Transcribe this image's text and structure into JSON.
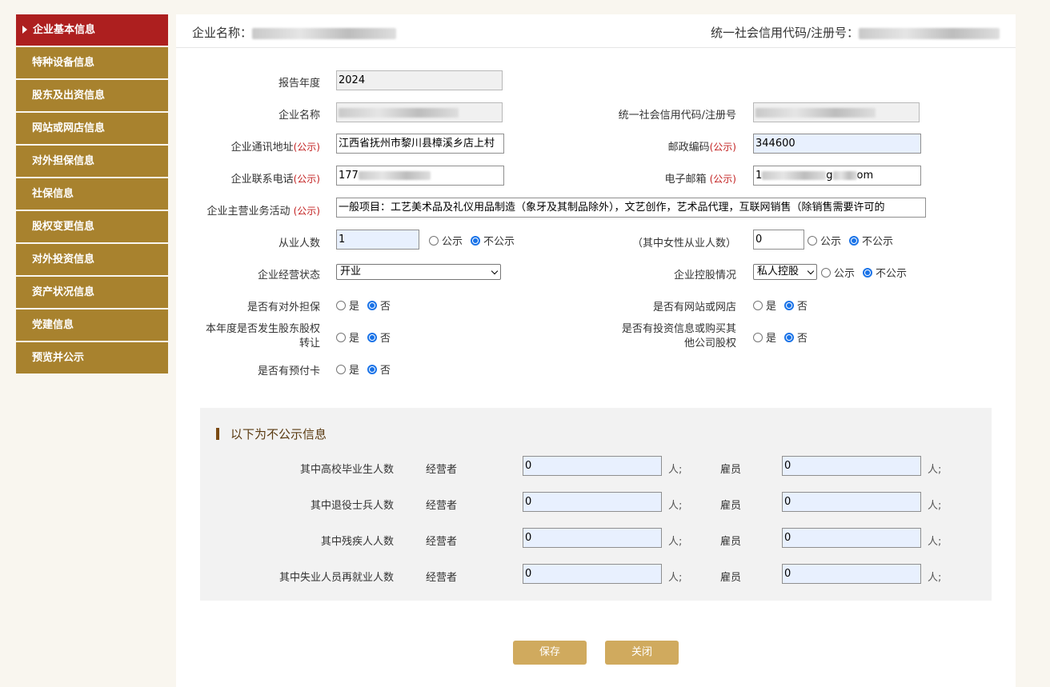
{
  "sidebar": {
    "items": [
      {
        "label": "企业基本信息",
        "active": true
      },
      {
        "label": "特种设备信息"
      },
      {
        "label": "股东及出资信息"
      },
      {
        "label": "网站或网店信息"
      },
      {
        "label": "对外担保信息"
      },
      {
        "label": "社保信息"
      },
      {
        "label": "股权变更信息"
      },
      {
        "label": "对外投资信息"
      },
      {
        "label": "资产状况信息"
      },
      {
        "label": "党建信息"
      },
      {
        "label": "预览并公示"
      }
    ]
  },
  "header": {
    "company_label": "企业名称：",
    "credit_label": "统一社会信用代码/注册号："
  },
  "form": {
    "report_year_label": "报告年度",
    "report_year_value": "2024",
    "company_name_label": "企业名称",
    "credit_code_label": "统一社会信用代码/注册号",
    "address_label": "企业通讯地址",
    "address_value": "江西省抚州市黎川县樟溪乡店上村",
    "public_tag": "(公示)",
    "postcode_label": "邮政编码",
    "postcode_value": "344600",
    "phone_label": "企业联系电话",
    "phone_value": "177",
    "email_label": "电子邮箱",
    "email_value_start": "1",
    "email_value_mid": "g",
    "email_value_end": "om",
    "business_label": "企业主营业务活动",
    "business_value": "一般项目：工艺美术品及礼仪用品制造（象牙及其制品除外），文艺创作，艺术品代理，互联网销售（除销售需要许可的",
    "employees_label": "从业人数",
    "employees_value": "1",
    "female_label": "（其中女性从业人数）",
    "female_value": "0",
    "status_label": "企业经营状态",
    "status_value": "开业",
    "holding_label": "企业控股情况",
    "holding_value": "私人控股",
    "guarantee_label": "是否有对外担保",
    "website_label": "是否有网站或网店",
    "equity_transfer_label_1": "本年度是否发生股东股权",
    "equity_transfer_label_2": "转让",
    "investment_label_1": "是否有投资信息或购买其",
    "investment_label_2": "他公司股权",
    "prepaid_label": "是否有预付卡",
    "opt_public": "公示",
    "opt_not_public": "不公示",
    "opt_yes": "是",
    "opt_no": "否"
  },
  "private": {
    "title": "以下为不公示信息",
    "operator_label": "经营者",
    "employee_label": "雇员",
    "unit": "人;",
    "rows": [
      {
        "label": "其中高校毕业生人数",
        "operator": "0",
        "employee": "0"
      },
      {
        "label": "其中退役士兵人数",
        "operator": "0",
        "employee": "0"
      },
      {
        "label": "其中残疾人人数",
        "operator": "0",
        "employee": "0"
      },
      {
        "label": "其中失业人员再就业人数",
        "operator": "0",
        "employee": "0"
      }
    ]
  },
  "buttons": {
    "save": "保存",
    "close": "关闭"
  }
}
